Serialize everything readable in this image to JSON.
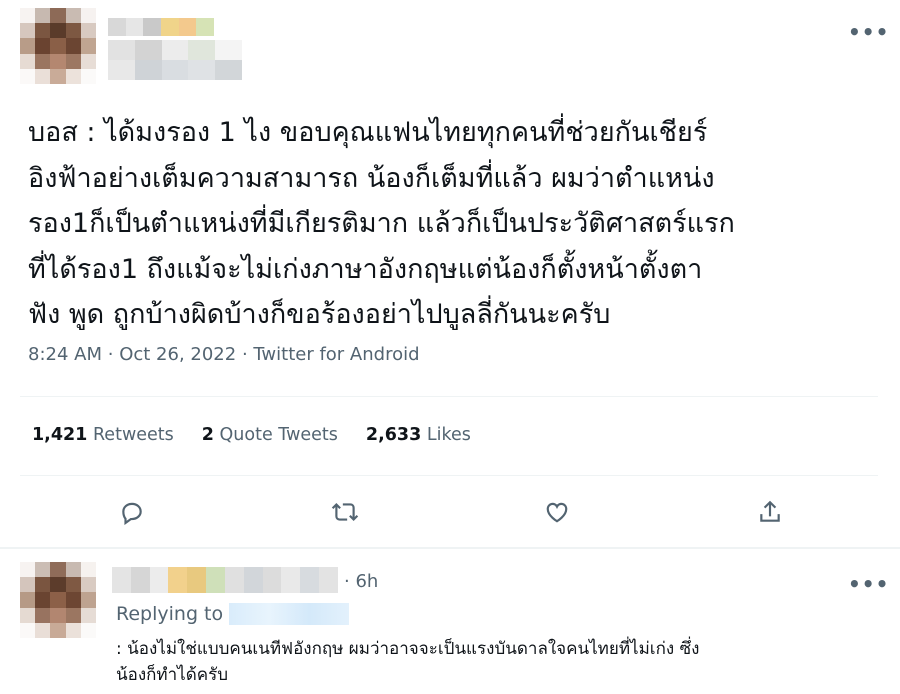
{
  "tweet": {
    "text": "บอส : ได้มงรอง 1 ไง ขอบคุณแฟนไทยทุกคนที่ช่วยกันเชียร์อิงฟ้าอย่างเต็มความสามารถ น้องก็เต็มที่แล้ว ผมว่าตำแหน่งรอง1ก็เป็นตำแหน่งที่มีเกียรติมาก แล้วก็เป็นประวัติศาสตร์แรกที่ได้รอง1 ถึงแม้จะไม่เก่งภาษาอังกฤษแต่น้องก็ตั้งหน้าตั้งตาฟัง พูด ถูกบ้างผิดบ้างก็ขอร้องอย่าไปบูลลี่กันนะครับ",
    "lines": [
      "บอส : ได้มงรอง 1 ไง ขอบคุณแฟนไทยทุกคนที่ช่วยกันเชียร์",
      "อิงฟ้าอย่างเต็มความสามารถ น้องก็เต็มที่แล้ว ผมว่าตำแหน่ง",
      "รอง1ก็เป็นตำแหน่งที่มีเกียรติมาก แล้วก็เป็นประวัติศาสตร์แรก",
      "ที่ได้รอง1 ถึงแม้จะไม่เก่งภาษาอังกฤษแต่น้องก็ตั้งหน้าตั้งตา",
      "ฟัง พูด ถูกบ้างผิดบ้างก็ขอร้องอย่าไปบูลลี่กันนะครับ"
    ],
    "time": "8:24 AM",
    "date": "Oct 26, 2022",
    "source": "Twitter for Android",
    "sep": "·",
    "more": "•••"
  },
  "stats": {
    "retweets_count": "1,421",
    "retweets_label": "Retweets",
    "quotes_count": "2",
    "quotes_label": "Quote Tweets",
    "likes_count": "2,633",
    "likes_label": "Likes"
  },
  "actions": {
    "icons": [
      "reply-icon",
      "retweet-icon",
      "like-icon",
      "share-icon"
    ]
  },
  "reply": {
    "time": "· 6h",
    "replying_to": "Replying to",
    "more": "•••",
    "lines": [
      ": น้องไม่ใช่แบบคนเนทีฟอังกฤษ ผมว่าอาจจะเป็นแรงบันดาลใจคนไทยที่ไม่เก่ง ซึ่ง",
      "น้องก็ทำได้ครับ"
    ]
  },
  "colors": {
    "text": "#0f1419",
    "secondary": "#536471",
    "divider": "#eff3f4",
    "link": "#1d9bf0"
  }
}
